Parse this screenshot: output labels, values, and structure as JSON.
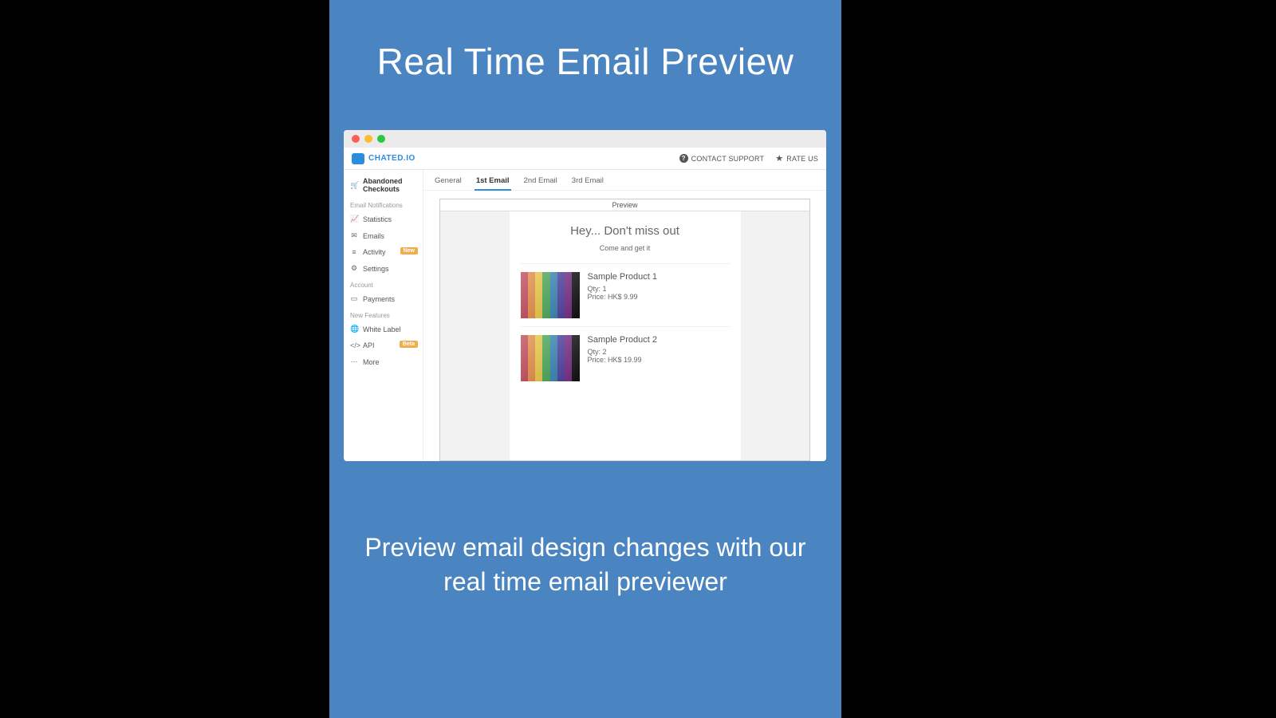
{
  "promo": {
    "title": "Real Time Email Preview",
    "subtitle": "Preview email design changes with our real time email previewer"
  },
  "app": {
    "brand": "CHATED.IO",
    "top_links": {
      "support": "CONTACT SUPPORT",
      "rate": "RATE US"
    },
    "sidebar": {
      "primary": "Abandoned Checkouts",
      "section_email": "Email Notifications",
      "statistics": "Statistics",
      "emails": "Emails",
      "activity": "Activity",
      "activity_badge": "New",
      "settings": "Settings",
      "section_account": "Account",
      "payments": "Payments",
      "section_new": "New Features",
      "white_label": "White Label",
      "api": "API",
      "api_badge": "Beta",
      "more": "More"
    },
    "tabs": {
      "general": "General",
      "first": "1st Email",
      "second": "2nd Email",
      "third": "3rd Email"
    },
    "preview_label": "Preview",
    "email": {
      "headline": "Hey... Don't miss out",
      "subline": "Come and get it",
      "products": [
        {
          "name": "Sample Product 1",
          "qty": "Qty: 1",
          "price": "Price: HK$ 9.99"
        },
        {
          "name": "Sample Product 2",
          "qty": "Qty: 2",
          "price": "Price: HK$ 19.99"
        }
      ]
    }
  }
}
